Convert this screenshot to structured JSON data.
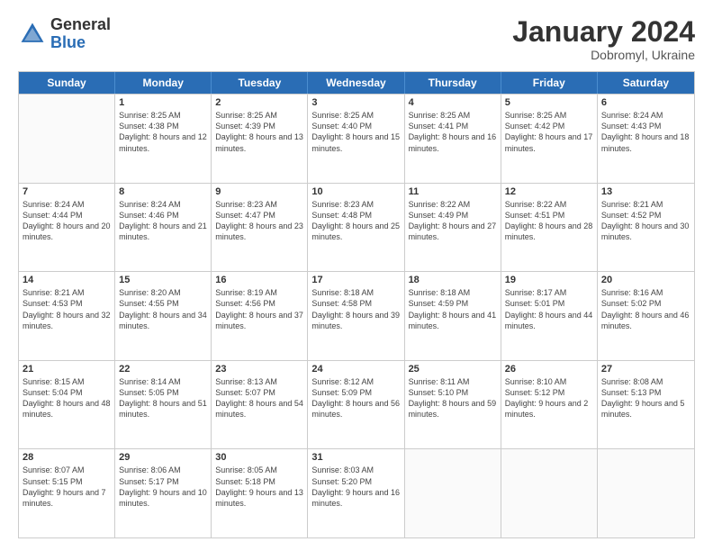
{
  "header": {
    "logo_general": "General",
    "logo_blue": "Blue",
    "month_title": "January 2024",
    "location": "Dobromyl, Ukraine"
  },
  "days_of_week": [
    "Sunday",
    "Monday",
    "Tuesday",
    "Wednesday",
    "Thursday",
    "Friday",
    "Saturday"
  ],
  "weeks": [
    [
      {
        "day": "",
        "sunrise": "",
        "sunset": "",
        "daylight": ""
      },
      {
        "day": "1",
        "sunrise": "Sunrise: 8:25 AM",
        "sunset": "Sunset: 4:38 PM",
        "daylight": "Daylight: 8 hours and 12 minutes."
      },
      {
        "day": "2",
        "sunrise": "Sunrise: 8:25 AM",
        "sunset": "Sunset: 4:39 PM",
        "daylight": "Daylight: 8 hours and 13 minutes."
      },
      {
        "day": "3",
        "sunrise": "Sunrise: 8:25 AM",
        "sunset": "Sunset: 4:40 PM",
        "daylight": "Daylight: 8 hours and 15 minutes."
      },
      {
        "day": "4",
        "sunrise": "Sunrise: 8:25 AM",
        "sunset": "Sunset: 4:41 PM",
        "daylight": "Daylight: 8 hours and 16 minutes."
      },
      {
        "day": "5",
        "sunrise": "Sunrise: 8:25 AM",
        "sunset": "Sunset: 4:42 PM",
        "daylight": "Daylight: 8 hours and 17 minutes."
      },
      {
        "day": "6",
        "sunrise": "Sunrise: 8:24 AM",
        "sunset": "Sunset: 4:43 PM",
        "daylight": "Daylight: 8 hours and 18 minutes."
      }
    ],
    [
      {
        "day": "7",
        "sunrise": "Sunrise: 8:24 AM",
        "sunset": "Sunset: 4:44 PM",
        "daylight": "Daylight: 8 hours and 20 minutes."
      },
      {
        "day": "8",
        "sunrise": "Sunrise: 8:24 AM",
        "sunset": "Sunset: 4:46 PM",
        "daylight": "Daylight: 8 hours and 21 minutes."
      },
      {
        "day": "9",
        "sunrise": "Sunrise: 8:23 AM",
        "sunset": "Sunset: 4:47 PM",
        "daylight": "Daylight: 8 hours and 23 minutes."
      },
      {
        "day": "10",
        "sunrise": "Sunrise: 8:23 AM",
        "sunset": "Sunset: 4:48 PM",
        "daylight": "Daylight: 8 hours and 25 minutes."
      },
      {
        "day": "11",
        "sunrise": "Sunrise: 8:22 AM",
        "sunset": "Sunset: 4:49 PM",
        "daylight": "Daylight: 8 hours and 27 minutes."
      },
      {
        "day": "12",
        "sunrise": "Sunrise: 8:22 AM",
        "sunset": "Sunset: 4:51 PM",
        "daylight": "Daylight: 8 hours and 28 minutes."
      },
      {
        "day": "13",
        "sunrise": "Sunrise: 8:21 AM",
        "sunset": "Sunset: 4:52 PM",
        "daylight": "Daylight: 8 hours and 30 minutes."
      }
    ],
    [
      {
        "day": "14",
        "sunrise": "Sunrise: 8:21 AM",
        "sunset": "Sunset: 4:53 PM",
        "daylight": "Daylight: 8 hours and 32 minutes."
      },
      {
        "day": "15",
        "sunrise": "Sunrise: 8:20 AM",
        "sunset": "Sunset: 4:55 PM",
        "daylight": "Daylight: 8 hours and 34 minutes."
      },
      {
        "day": "16",
        "sunrise": "Sunrise: 8:19 AM",
        "sunset": "Sunset: 4:56 PM",
        "daylight": "Daylight: 8 hours and 37 minutes."
      },
      {
        "day": "17",
        "sunrise": "Sunrise: 8:18 AM",
        "sunset": "Sunset: 4:58 PM",
        "daylight": "Daylight: 8 hours and 39 minutes."
      },
      {
        "day": "18",
        "sunrise": "Sunrise: 8:18 AM",
        "sunset": "Sunset: 4:59 PM",
        "daylight": "Daylight: 8 hours and 41 minutes."
      },
      {
        "day": "19",
        "sunrise": "Sunrise: 8:17 AM",
        "sunset": "Sunset: 5:01 PM",
        "daylight": "Daylight: 8 hours and 44 minutes."
      },
      {
        "day": "20",
        "sunrise": "Sunrise: 8:16 AM",
        "sunset": "Sunset: 5:02 PM",
        "daylight": "Daylight: 8 hours and 46 minutes."
      }
    ],
    [
      {
        "day": "21",
        "sunrise": "Sunrise: 8:15 AM",
        "sunset": "Sunset: 5:04 PM",
        "daylight": "Daylight: 8 hours and 48 minutes."
      },
      {
        "day": "22",
        "sunrise": "Sunrise: 8:14 AM",
        "sunset": "Sunset: 5:05 PM",
        "daylight": "Daylight: 8 hours and 51 minutes."
      },
      {
        "day": "23",
        "sunrise": "Sunrise: 8:13 AM",
        "sunset": "Sunset: 5:07 PM",
        "daylight": "Daylight: 8 hours and 54 minutes."
      },
      {
        "day": "24",
        "sunrise": "Sunrise: 8:12 AM",
        "sunset": "Sunset: 5:09 PM",
        "daylight": "Daylight: 8 hours and 56 minutes."
      },
      {
        "day": "25",
        "sunrise": "Sunrise: 8:11 AM",
        "sunset": "Sunset: 5:10 PM",
        "daylight": "Daylight: 8 hours and 59 minutes."
      },
      {
        "day": "26",
        "sunrise": "Sunrise: 8:10 AM",
        "sunset": "Sunset: 5:12 PM",
        "daylight": "Daylight: 9 hours and 2 minutes."
      },
      {
        "day": "27",
        "sunrise": "Sunrise: 8:08 AM",
        "sunset": "Sunset: 5:13 PM",
        "daylight": "Daylight: 9 hours and 5 minutes."
      }
    ],
    [
      {
        "day": "28",
        "sunrise": "Sunrise: 8:07 AM",
        "sunset": "Sunset: 5:15 PM",
        "daylight": "Daylight: 9 hours and 7 minutes."
      },
      {
        "day": "29",
        "sunrise": "Sunrise: 8:06 AM",
        "sunset": "Sunset: 5:17 PM",
        "daylight": "Daylight: 9 hours and 10 minutes."
      },
      {
        "day": "30",
        "sunrise": "Sunrise: 8:05 AM",
        "sunset": "Sunset: 5:18 PM",
        "daylight": "Daylight: 9 hours and 13 minutes."
      },
      {
        "day": "31",
        "sunrise": "Sunrise: 8:03 AM",
        "sunset": "Sunset: 5:20 PM",
        "daylight": "Daylight: 9 hours and 16 minutes."
      },
      {
        "day": "",
        "sunrise": "",
        "sunset": "",
        "daylight": ""
      },
      {
        "day": "",
        "sunrise": "",
        "sunset": "",
        "daylight": ""
      },
      {
        "day": "",
        "sunrise": "",
        "sunset": "",
        "daylight": ""
      }
    ]
  ]
}
